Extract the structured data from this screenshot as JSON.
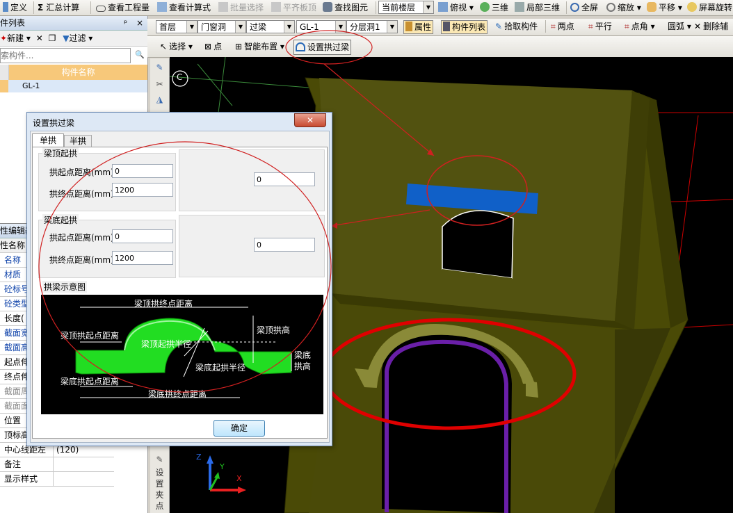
{
  "toolbar1": {
    "define": "定义",
    "summary": "汇总计算",
    "view_quantity": "查看工程量",
    "view_formula": "查看计算式",
    "batch_select": "批量选择",
    "align_slab": "平齐板顶",
    "find_element": "查找图元",
    "floor_label": "当前楼层",
    "top_view": "俯视",
    "three_d": "三维",
    "local_3d": "局部三维",
    "fullscreen": "全屏",
    "zoom": "缩放",
    "pan": "平移",
    "rotate": "屏幕旋转"
  },
  "toolbar2": {
    "floor": "首层",
    "category": "门窗洞",
    "type": "过梁",
    "element": "GL-1",
    "sublayer": "分层洞1",
    "properties": "属性",
    "component_list": "构件列表",
    "pick_component": "拾取构件",
    "two_points": "两点",
    "parallel": "平行",
    "point_angle": "点角",
    "arc": "圆弧",
    "delete_aux": "删除辅"
  },
  "toolbar3": {
    "select": "选择",
    "point": "点",
    "smart_place": "智能布置",
    "set_arch_lintel": "设置拱过梁"
  },
  "left_panel": {
    "title": "件列表",
    "new_label": "新建",
    "filter_label": "过滤",
    "search_placeholder": "索构件...",
    "column_header": "构件名称",
    "rows": [
      "GL-1"
    ]
  },
  "prop_panel": {
    "title": "性编辑器",
    "header": "性名称",
    "items": [
      {
        "name": "名称",
        "value": "",
        "style": "blue"
      },
      {
        "name": "材质",
        "value": "",
        "style": "blue"
      },
      {
        "name": "砼标号",
        "value": "",
        "style": "blue"
      },
      {
        "name": "砼类型",
        "value": "",
        "style": "blue"
      },
      {
        "name": "长度(",
        "value": "",
        "style": "normal"
      },
      {
        "name": "截面宽",
        "value": "",
        "style": "blue"
      },
      {
        "name": "截面高",
        "value": "",
        "style": "blue"
      },
      {
        "name": "起点伸",
        "value": "",
        "style": "normal"
      },
      {
        "name": "终点伸",
        "value": "",
        "style": "normal"
      },
      {
        "name": "截面周",
        "value": "",
        "style": "gray"
      },
      {
        "name": "截面面",
        "value": "",
        "style": "gray"
      },
      {
        "name": "位置",
        "value": "",
        "style": "normal"
      },
      {
        "name": "顶标高",
        "value": "",
        "style": "normal"
      },
      {
        "name": "中心线距左",
        "value": "(120)",
        "style": "normal"
      },
      {
        "name": "备注",
        "value": "",
        "style": "normal"
      },
      {
        "name": "显示样式",
        "value": "",
        "style": "normal"
      }
    ]
  },
  "vertical_tool": {
    "label_chars": [
      "设",
      "置",
      "夹",
      "点"
    ]
  },
  "dialog": {
    "title": "设置拱过梁",
    "close": "✕",
    "tabs": [
      "单拱",
      "半拱"
    ],
    "top_group": {
      "title": "梁顶起拱",
      "start_label": "拱起点距离(mm)",
      "start_value": "0",
      "end_label": "拱终点距离(mm)",
      "end_value": "1200",
      "height_value": "0"
    },
    "bottom_group": {
      "title": "梁底起拱",
      "start_label": "拱起点距离(mm)",
      "start_value": "0",
      "end_label": "拱终点距离(mm)",
      "end_value": "1200",
      "height_value": "0"
    },
    "diagram_group": {
      "title": "拱梁示意图",
      "labels": {
        "top_end": "梁顶拱终点距离",
        "top_start": "梁顶拱起点距离",
        "top_radius": "梁顶起拱半径",
        "top_height": "梁顶拱高",
        "bottom_radius": "梁底起拱半径",
        "bottom_height_1": "梁底",
        "bottom_height_2": "拱高",
        "bottom_start": "梁底拱起点距离",
        "bottom_end": "梁底拱终点距离"
      }
    },
    "ok": "确定"
  },
  "viewport": {
    "label_c": "C",
    "axis_x": "X",
    "axis_y": "Y",
    "axis_z": "Z"
  },
  "colors": {
    "wall": "#4a4a06",
    "beam": "#1060c8",
    "arch": "#8a8a38",
    "opening_edge": "#6a1fa8",
    "annotation_red": "#e00000",
    "arch_green": "#22dd22"
  }
}
